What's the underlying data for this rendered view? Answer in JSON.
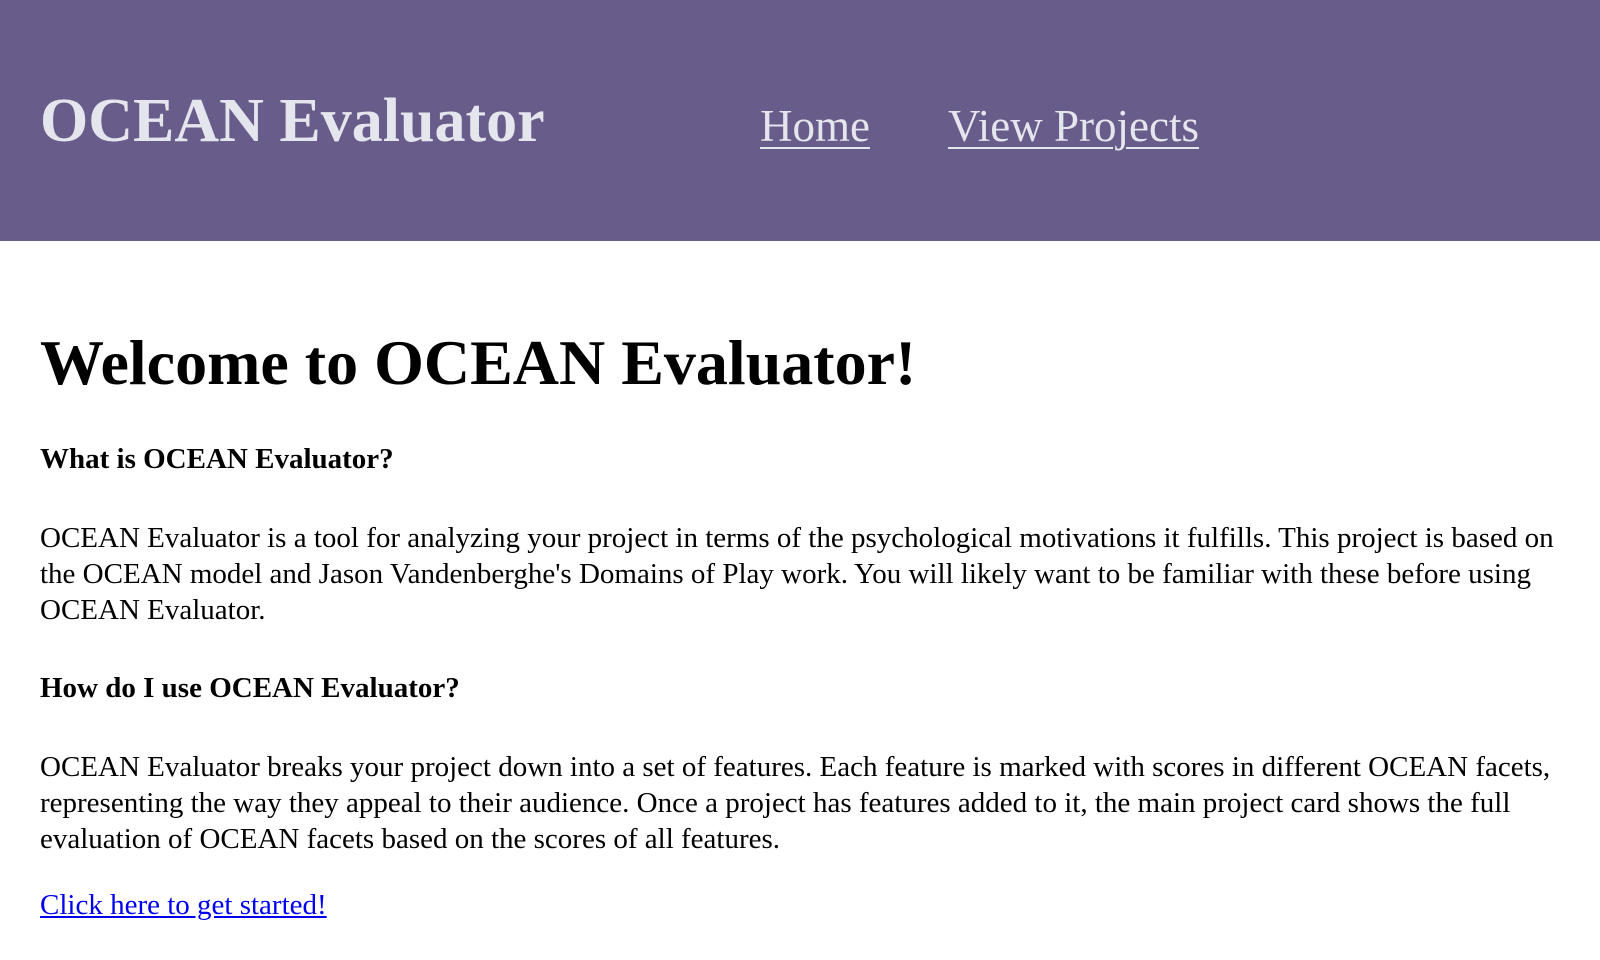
{
  "header": {
    "site_title": "OCEAN Evaluator",
    "nav": [
      {
        "label": "Home"
      },
      {
        "label": "View Projects"
      }
    ],
    "background_color": "#685c8b",
    "text_color": "#e5e5ee"
  },
  "main": {
    "title": "Welcome to OCEAN Evaluator!",
    "sections": [
      {
        "heading": "What is OCEAN Evaluator?",
        "body": "OCEAN Evaluator is a tool for analyzing your project in terms of the psychological motivations it fulfills. This project is based on the OCEAN model and Jason Vandenberghe's Domains of Play work. You will likely want to be familiar with these before using OCEAN Evaluator."
      },
      {
        "heading": "How do I use OCEAN Evaluator?",
        "body": "OCEAN Evaluator breaks your project down into a set of features. Each feature is marked with scores in different OCEAN facets, representing the way they appeal to their audience. Once a project has features added to it, the main project card shows the full evaluation of OCEAN facets based on the scores of all features."
      }
    ],
    "cta_link": "Click here to get started!",
    "link_color": "#0000ee"
  }
}
